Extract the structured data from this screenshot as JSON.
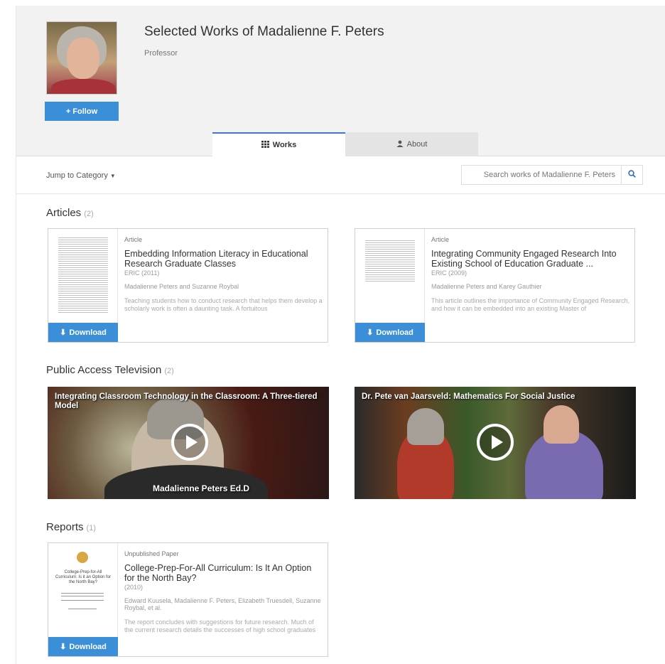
{
  "profile": {
    "name": "Selected Works of Madalienne F. Peters",
    "title": "Professor",
    "follow_label": "Follow"
  },
  "tabs": {
    "works_label": "Works",
    "about_label": "About"
  },
  "toolbar": {
    "jump_label": "Jump to Category",
    "search_placeholder": "Search works of Madalienne F. Peters"
  },
  "sections": {
    "articles": {
      "label": "Articles",
      "count": "(2)"
    },
    "tv": {
      "label": "Public Access Television",
      "count": "(2)"
    },
    "reports": {
      "label": "Reports",
      "count": "(1)"
    }
  },
  "articles": [
    {
      "type": "Article",
      "title": "Embedding Information Literacy in Educational Research Graduate Classes",
      "pub": "ERIC (2011)",
      "authors": "Madalienne Peters and Suzanne Roybal",
      "abstract": "Teaching students how to conduct research that helps them develop a scholarly work is often a daunting task. A fortuitous",
      "download_label": "Download"
    },
    {
      "type": "Article",
      "title": "Integrating Community Engaged Research Into Existing School of Education Graduate ...",
      "pub": "ERIC (2009)",
      "authors": "Madalienne Peters and Karey Gauthier",
      "abstract": "This article outlines the importance of Community Engaged Research, and how it can be embedded into an existing Master of",
      "download_label": "Download"
    }
  ],
  "videos": [
    {
      "title": "Integrating Classroom Technology in the Classroom: A Three-tiered Model",
      "caption": "Madalienne Peters Ed.D"
    },
    {
      "title": "Dr. Pete van Jaarsveld: Mathematics For Social Justice"
    }
  ],
  "reports": [
    {
      "type": "Unpublished Paper",
      "title": "College-Prep-For-All Curriculum: Is It An Option for the North Bay?",
      "pub": "(2010)",
      "authors": "Edward Kuusela, Madalienne F. Peters, Elizabeth Truesdell, Suzanne Roybal, et al.",
      "abstract": "The report concludes with suggestions for future research. Much of the current research details the successes of high school graduates",
      "download_label": "Download",
      "thumb_text": "College-Prep-for-All Curriculum: Is it an Option for the North Bay?"
    }
  ],
  "colors": {
    "accent": "#3a8fd8",
    "tab_active_border": "#3a7bc8"
  },
  "icons": [
    "plus-icon",
    "grid-icon",
    "user-icon",
    "caret-down-icon",
    "search-icon",
    "download-icon",
    "play-icon"
  ]
}
